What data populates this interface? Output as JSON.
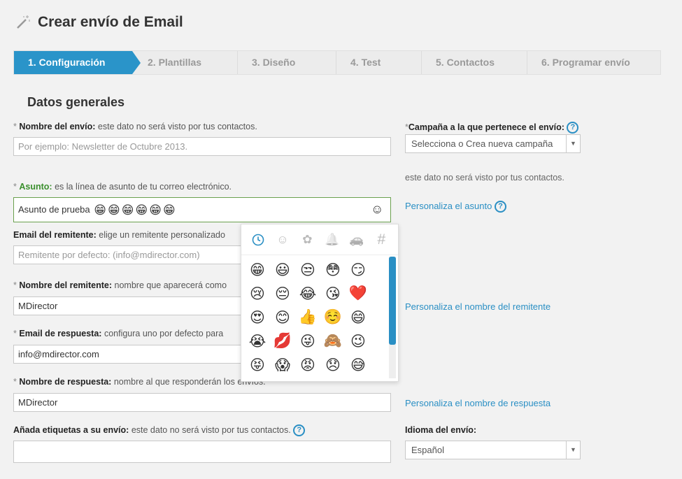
{
  "page": {
    "title": "Crear envío de Email",
    "title_icon": "magic-wand-icon"
  },
  "steps": [
    {
      "label": "1. Configuración",
      "active": true
    },
    {
      "label": "2. Plantillas",
      "active": false
    },
    {
      "label": "3. Diseño",
      "active": false
    },
    {
      "label": "4. Test",
      "active": false
    },
    {
      "label": "5. Contactos",
      "active": false
    },
    {
      "label": "6. Programar envío",
      "active": false
    }
  ],
  "section": {
    "title": "Datos generales"
  },
  "form": {
    "nombre_envio": {
      "required": "*",
      "label": "Nombre del envío:",
      "hint": "este dato no será visto por tus contactos.",
      "placeholder": "Por ejemplo: Newsletter de Octubre 2013."
    },
    "asunto": {
      "required": "*",
      "label": "Asunto:",
      "hint": "es la línea de asunto de tu correo electrónico.",
      "value": "Asunto de prueba",
      "emojis": [
        "😁",
        "😁",
        "😁",
        "😁",
        "😁",
        "😁"
      ],
      "emoji_button": "☺"
    },
    "email_remitente": {
      "label": "Email del remitente:",
      "hint": "elige un remitente personalizado",
      "placeholder": "Remitente por defecto: (info@mdirector.com)"
    },
    "nombre_remitente": {
      "required": "*",
      "label": "Nombre del remitente:",
      "hint": "nombre que aparecerá como",
      "value": "MDirector"
    },
    "email_respuesta": {
      "required": "*",
      "label": "Email de respuesta:",
      "hint": "configura uno por defecto para",
      "value": "info@mdirector.com"
    },
    "nombre_respuesta": {
      "required": "*",
      "label": "Nombre de respuesta:",
      "hint": "nombre al que responderán los envíos.",
      "value": "MDirector"
    },
    "etiquetas": {
      "label": "Añada etiquetas a su envío:",
      "hint": "este dato no será visto por tus contactos.",
      "value": ""
    }
  },
  "right": {
    "campana": {
      "required": "*",
      "label": "Campaña a la que pertenece el envío:",
      "selected": "Selecciona o Crea nueva campaña"
    },
    "note": "este dato no será visto por tus contactos.",
    "link_asunto": "Personaliza el asunto",
    "link_remitente": "Personaliza el nombre del remitente",
    "link_respuesta": "Personaliza el nombre de respuesta",
    "idioma": {
      "label": "Idioma del envío:",
      "selected": "Español"
    }
  },
  "help_glyph": "?",
  "picker": {
    "tabs": [
      "recent-clock-icon",
      "smiley-icon",
      "flower-icon",
      "bell-icon",
      "car-icon",
      "hashtag-icon"
    ],
    "tab_glyphs": [
      "",
      "☺",
      "✿",
      "🔔",
      "🚗",
      "#"
    ],
    "emojis": [
      "😁",
      "😃",
      "😒",
      "😳",
      "😏",
      "😢",
      "😔",
      "😂",
      "😘",
      "❤️",
      "😍",
      "😊",
      "👍",
      "☺️",
      "😄",
      "😭",
      "💋",
      "😜",
      "🙈",
      "😉",
      "😝",
      "😱",
      "😡",
      "😞",
      "😅"
    ]
  }
}
